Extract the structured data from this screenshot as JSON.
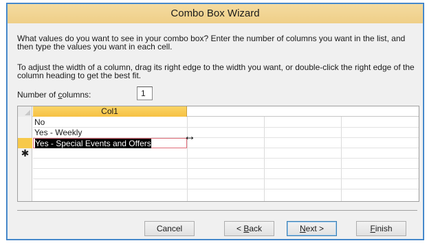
{
  "window": {
    "title": "Combo Box Wizard"
  },
  "instructions": {
    "line1": "What values do you want to see in your combo box? Enter the number of columns you want in the list, and then type the values you want in each cell.",
    "line2": "To adjust the width of a column, drag its right edge to the width you want, or double-click the right edge of the column heading to get the best fit."
  },
  "columns": {
    "label_prefix": "Number of ",
    "label_accel": "c",
    "label_suffix": "olumns:",
    "value": "1"
  },
  "grid": {
    "header": "Col1",
    "rows": [
      "No",
      "Yes - Weekly",
      "Yes - Special Events and Offers"
    ],
    "new_row_marker": "✱",
    "resize_cursor": "↔"
  },
  "buttons": {
    "cancel": "Cancel",
    "back_prefix": "< ",
    "back_accel": "B",
    "back_suffix": "ack",
    "next_accel": "N",
    "next_suffix": "ext >",
    "finish_accel": "F",
    "finish_suffix": "inish"
  },
  "colors": {
    "title_bar": "#efcf88",
    "column_header": "#f6c143",
    "current_row_selector": "#f7c94a",
    "edit_border": "#e06b78",
    "dialog_bg": "#f0f0f0"
  }
}
